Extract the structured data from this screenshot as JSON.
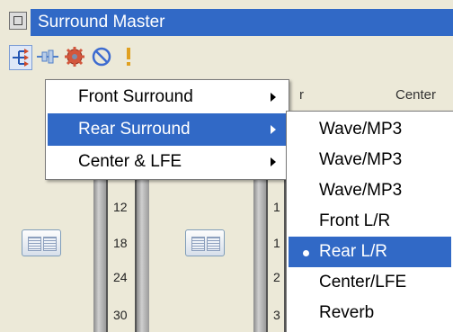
{
  "window": {
    "title": "Surround Master"
  },
  "toolbar": {
    "buttons": [
      {
        "icon": "routing-icon",
        "pressed": true
      },
      {
        "icon": "connector-icon",
        "pressed": false
      },
      {
        "icon": "gear-icon",
        "pressed": false
      },
      {
        "icon": "no-entry-icon",
        "pressed": false
      },
      {
        "icon": "exclamation-icon",
        "pressed": false
      }
    ]
  },
  "panel": {
    "columns": [
      "r",
      "Center"
    ],
    "scale_ticks": [
      "12",
      "18",
      "24",
      "30"
    ],
    "scale_ticks_partial": [
      "1",
      "1",
      "2",
      "3"
    ]
  },
  "menu": {
    "items": [
      {
        "label": "Front Surround",
        "has_submenu": true,
        "selected": false
      },
      {
        "label": "Rear Surround",
        "has_submenu": true,
        "selected": true
      },
      {
        "label": "Center & LFE",
        "has_submenu": true,
        "selected": false
      }
    ]
  },
  "submenu": {
    "items": [
      {
        "label": "Wave/MP3",
        "checked": false,
        "selected": false
      },
      {
        "label": "Wave/MP3",
        "checked": false,
        "selected": false
      },
      {
        "label": "Wave/MP3",
        "checked": false,
        "selected": false
      },
      {
        "label": "Front L/R",
        "checked": false,
        "selected": false
      },
      {
        "label": "Rear L/R",
        "checked": true,
        "selected": true
      },
      {
        "label": "Center/LFE",
        "checked": false,
        "selected": false
      },
      {
        "label": "Reverb",
        "checked": false,
        "selected": false
      }
    ]
  },
  "colors": {
    "selection": "#3169c6",
    "title_band": "#3169c6",
    "background": "#ece9d8"
  }
}
